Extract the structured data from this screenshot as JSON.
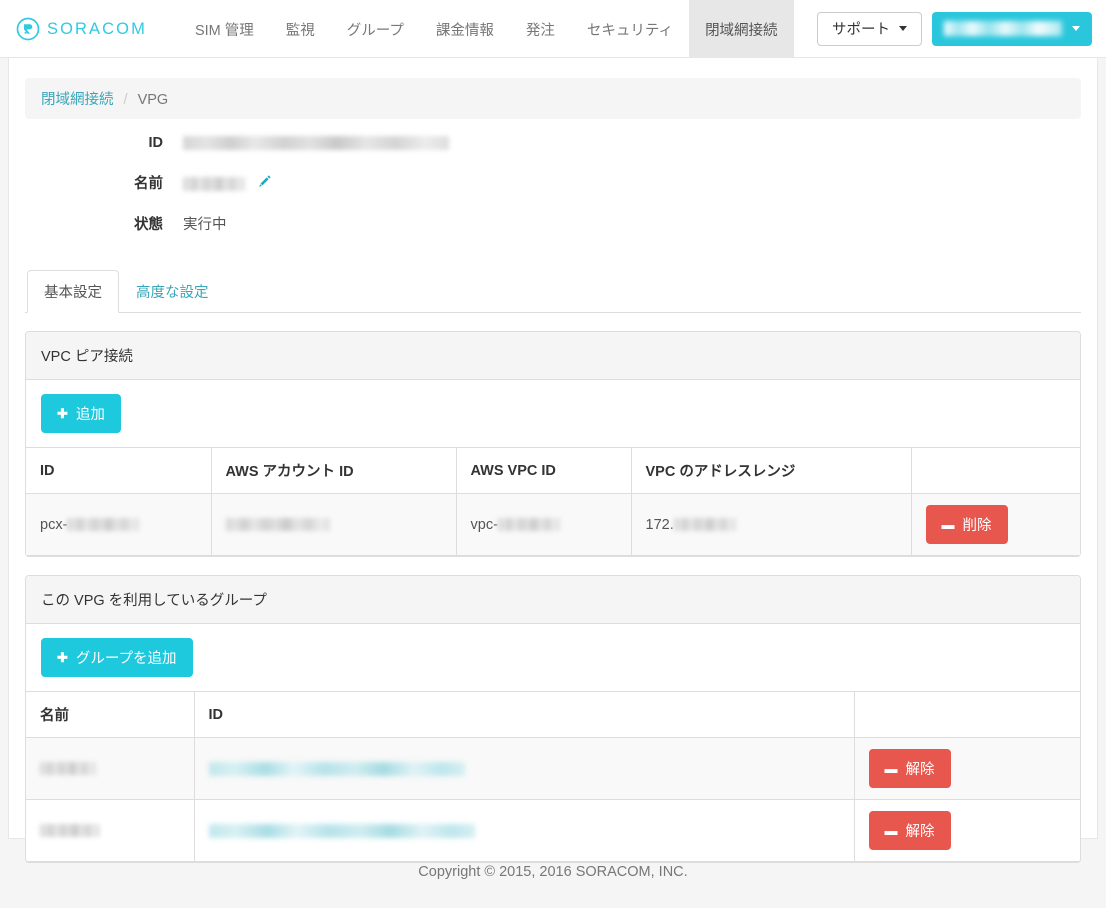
{
  "brand": {
    "name": "SORACOM",
    "logo_icon": "soracom-circle-logo"
  },
  "nav": {
    "items": [
      {
        "label": "SIM 管理",
        "active": false
      },
      {
        "label": "監視",
        "active": false
      },
      {
        "label": "グループ",
        "active": false
      },
      {
        "label": "課金情報",
        "active": false
      },
      {
        "label": "発注",
        "active": false
      },
      {
        "label": "セキュリティ",
        "active": false
      },
      {
        "label": "閉域網接続",
        "active": true
      }
    ],
    "support_label": "サポート",
    "account_label": ""
  },
  "breadcrumb": {
    "parent": "閉域網接続",
    "separator": "/",
    "current": "VPG"
  },
  "detail": {
    "id_label": "ID",
    "id_value": "",
    "name_label": "名前",
    "name_value": "",
    "edit_icon": "pencil-icon",
    "status_label": "状態",
    "status_value": "実行中"
  },
  "tabs": [
    {
      "label": "基本設定",
      "active": true
    },
    {
      "label": "高度な設定",
      "active": false
    }
  ],
  "vpc_panel": {
    "title": "VPC ピア接続",
    "add_label": "追加",
    "add_icon": "plus-icon",
    "columns": [
      "ID",
      "AWS アカウント ID",
      "AWS VPC ID",
      "VPC のアドレスレンジ",
      ""
    ],
    "rows": [
      {
        "id_prefix": "pcx-",
        "aws_account_id": "",
        "vpc_id_prefix": "vpc-",
        "address_range_prefix": "172.",
        "delete_label": "削除",
        "delete_icon": "minus-icon"
      }
    ]
  },
  "group_panel": {
    "title": "この VPG を利用しているグループ",
    "add_label": "グループを追加",
    "add_icon": "plus-icon",
    "columns": [
      "名前",
      "ID",
      ""
    ],
    "rows": [
      {
        "name": "",
        "id": "",
        "action_label": "解除",
        "action_icon": "minus-icon"
      },
      {
        "name": "",
        "id": "",
        "action_label": "解除",
        "action_icon": "minus-icon"
      }
    ]
  },
  "footer": {
    "copyright": "Copyright © 2015, 2016 SORACOM, INC."
  },
  "colors": {
    "accent_teal": "#1ec8dd",
    "brand_teal": "#2ecbe0",
    "danger_red": "#e8574e",
    "link_teal": "#3aa6b9",
    "panel_head_bg": "#f5f5f5",
    "page_bg": "#f5f5f5"
  }
}
